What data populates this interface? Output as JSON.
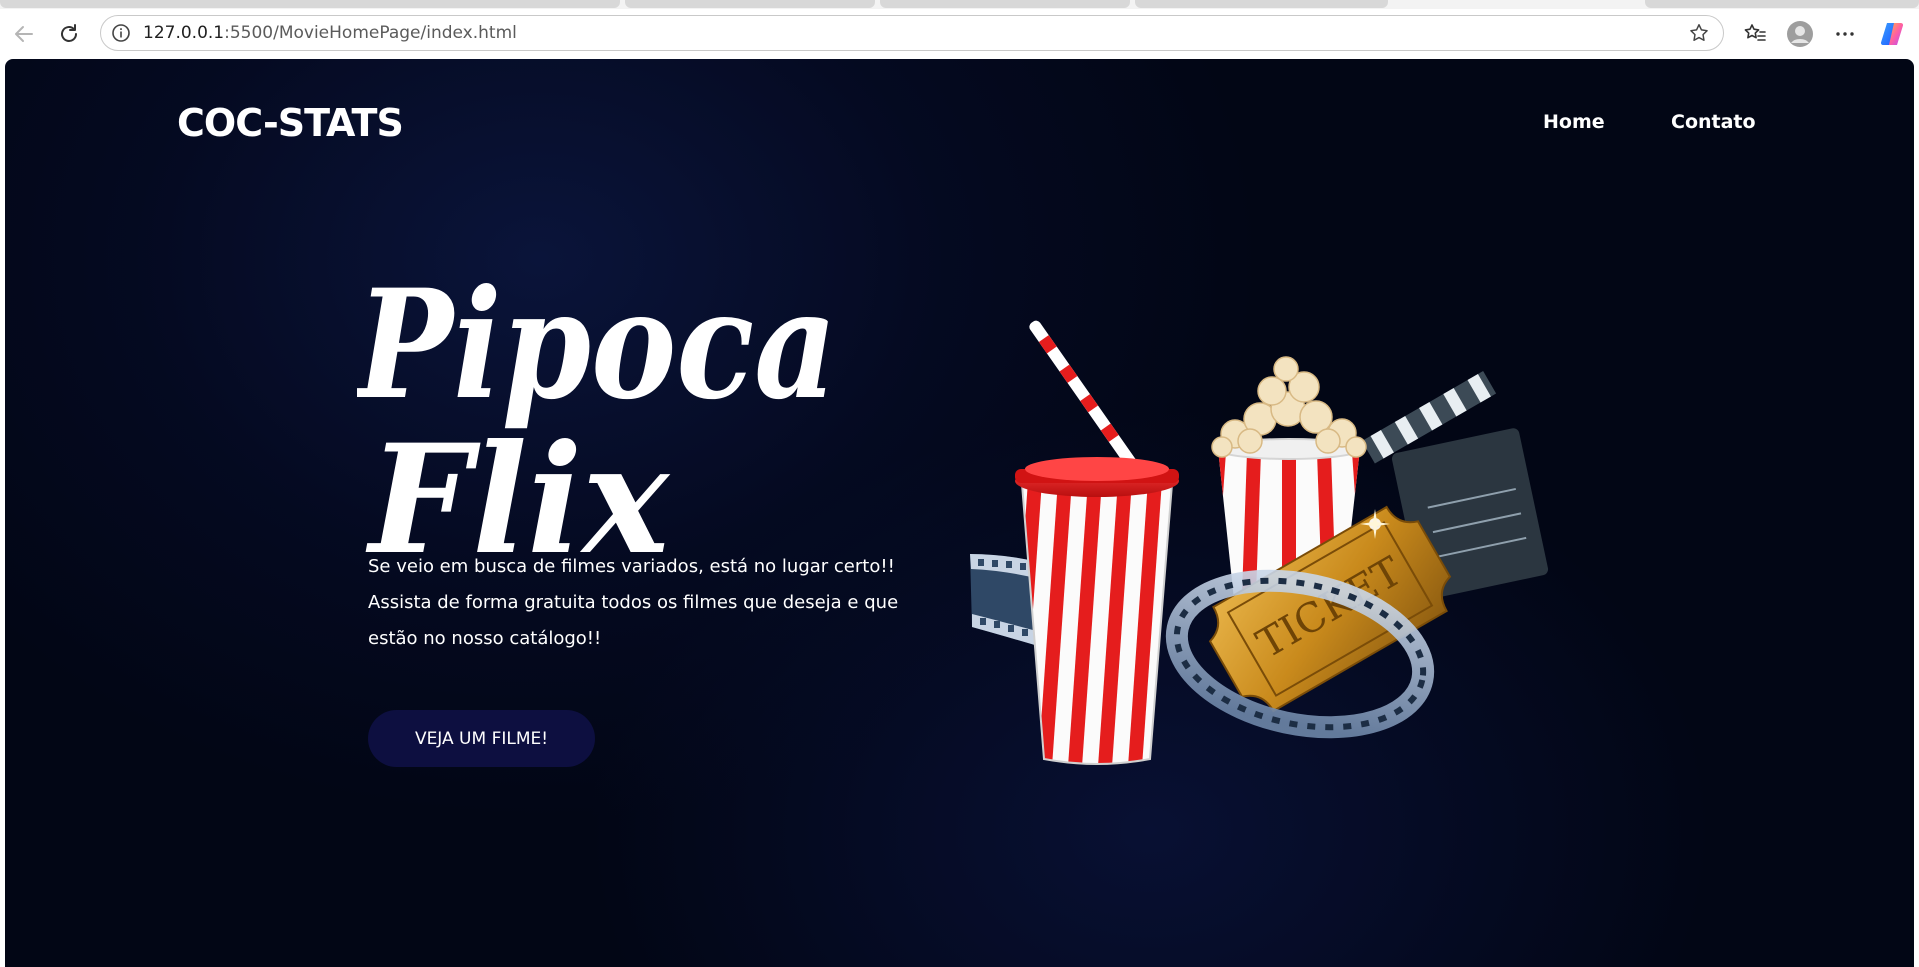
{
  "browser": {
    "url_host": "127.0.0.1",
    "url_path": ":5500/MovieHomePage/index.html",
    "icons": [
      "back-arrow-icon",
      "refresh-icon",
      "site-info-icon",
      "star-icon",
      "favorites-icon",
      "profile-icon",
      "more-icon",
      "copilot-icon"
    ]
  },
  "header": {
    "logo": "COC-STATS",
    "nav": [
      "Home",
      "Contato"
    ]
  },
  "hero": {
    "title_line1": "Pipoca",
    "title_line2": "Flix",
    "description": [
      "Se veio em busca de filmes variados, está no lugar certo!!",
      "Assista de forma gratuita todos os filmes que deseja e que",
      "estão no nosso catálogo!!"
    ],
    "cta_label": "VEJA UM FILME!",
    "illustration_ticket_text": "TICKET"
  },
  "colors": {
    "background": "#020615",
    "button": "#0d0f40",
    "text": "#ffffff"
  }
}
